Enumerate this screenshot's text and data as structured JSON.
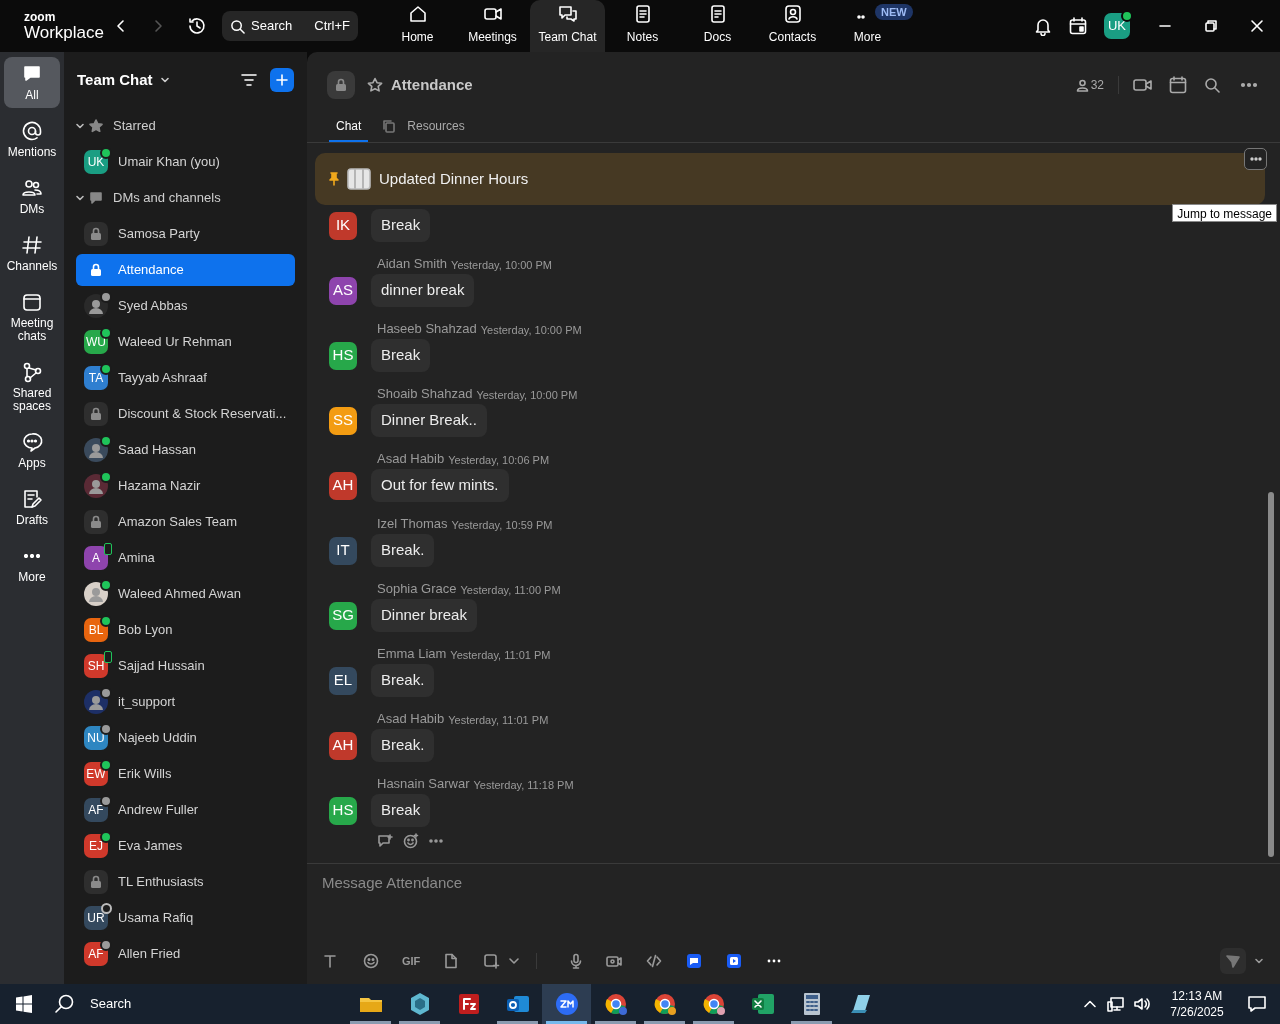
{
  "app": {
    "logo_top": "zoom",
    "logo_bottom": "Workplace"
  },
  "search": {
    "placeholder": "Search",
    "shortcut": "Ctrl+F"
  },
  "nav_tabs": [
    {
      "label": "Home",
      "selected": false
    },
    {
      "label": "Meetings",
      "selected": false
    },
    {
      "label": "Team Chat",
      "selected": true
    },
    {
      "label": "Notes",
      "selected": false
    },
    {
      "label": "Docs",
      "selected": false
    },
    {
      "label": "Contacts",
      "selected": false
    },
    {
      "label": "More",
      "selected": false,
      "badge": "NEW"
    }
  ],
  "profile": {
    "initials": "UK",
    "color": "#1a9e83",
    "presence": {
      "kind": "dot",
      "color": "#1fc45a"
    }
  },
  "rail": [
    {
      "label": "All",
      "selected": true
    },
    {
      "label": "Mentions",
      "selected": false
    },
    {
      "label": "DMs",
      "selected": false
    },
    {
      "label": "Channels",
      "selected": false
    },
    {
      "label": "Meeting chats",
      "selected": false
    },
    {
      "label": "Shared spaces",
      "selected": false
    },
    {
      "label": "Apps",
      "selected": false
    },
    {
      "label": "Drafts",
      "selected": false
    },
    {
      "label": "More",
      "selected": false
    }
  ],
  "sidebar": {
    "title": "Team Chat",
    "sections": [
      {
        "label": "Starred",
        "expanded": true,
        "items": [
          {
            "kind": "initials",
            "name": "Umair Khan (you)",
            "initials": "UK",
            "color": "#1a9e83",
            "presence": {
              "kind": "dot",
              "color": "#1fc45a"
            },
            "selected": false
          }
        ]
      },
      {
        "label": "DMs and channels",
        "expanded": true,
        "items": [
          {
            "kind": "channel",
            "name": "Samosa Party",
            "selected": false
          },
          {
            "kind": "channel",
            "name": "Attendance",
            "selected": true
          },
          {
            "kind": "photo",
            "name": "Syed Abbas",
            "color": "#2a2a2a",
            "presence": {
              "kind": "dot",
              "color": "#9a9a9a"
            },
            "selected": false
          },
          {
            "kind": "initials",
            "name": "Waleed Ur Rehman",
            "initials": "WU",
            "color": "#27a84a",
            "presence": {
              "kind": "dot",
              "color": "#1fc45a"
            },
            "selected": false
          },
          {
            "kind": "initials",
            "name": "Tayyab Ashraaf",
            "initials": "TA",
            "color": "#2f7fd0",
            "presence": {
              "kind": "dot",
              "color": "#1fc45a"
            },
            "selected": false
          },
          {
            "kind": "channel",
            "name": "Discount & Stock Reservati...",
            "selected": false
          },
          {
            "kind": "photo",
            "name": "Saad Hassan",
            "color": "#3a4a5c",
            "presence": {
              "kind": "dot",
              "color": "#1fc45a"
            },
            "selected": false
          },
          {
            "kind": "photo",
            "name": "Hazama Nazir",
            "color": "#5a2a35",
            "presence": {
              "kind": "dot",
              "color": "#1fc45a"
            },
            "selected": false
          },
          {
            "kind": "channel",
            "name": "Amazon Sales Team",
            "selected": false
          },
          {
            "kind": "initials",
            "name": "Amina",
            "initials": "A",
            "color": "#8e44ad",
            "presence": {
              "kind": "mobile",
              "color": "#1fc45a"
            },
            "selected": false
          },
          {
            "kind": "photo",
            "name": "Waleed Ahmed Awan",
            "color": "#d8d0c8",
            "presence": {
              "kind": "dot",
              "color": "#1fc45a"
            },
            "selected": false
          },
          {
            "kind": "initials",
            "name": "Bob Lyon",
            "initials": "BL",
            "color": "#e8650f",
            "presence": {
              "kind": "dot",
              "color": "#1fc45a"
            },
            "selected": false
          },
          {
            "kind": "initials",
            "name": "Sajjad Hussain",
            "initials": "SH",
            "color": "#d0392b",
            "presence": {
              "kind": "mobile",
              "color": "#1fc45a"
            },
            "selected": false
          },
          {
            "kind": "photo",
            "name": "it_support",
            "color": "#1d2f66",
            "presence": {
              "kind": "dot",
              "color": "#9a9a9a"
            },
            "selected": false
          },
          {
            "kind": "initials",
            "name": "Najeeb Uddin",
            "initials": "NU",
            "color": "#2e86c1",
            "presence": {
              "kind": "dot",
              "color": "#9a9a9a"
            },
            "selected": false
          },
          {
            "kind": "initials",
            "name": "Erik Wills",
            "initials": "EW",
            "color": "#d0392b",
            "presence": {
              "kind": "dot",
              "color": "#1fc45a"
            },
            "selected": false
          },
          {
            "kind": "initials",
            "name": "Andrew Fuller",
            "initials": "AF",
            "color": "#34495e",
            "presence": {
              "kind": "dot",
              "color": "#9a9a9a"
            },
            "selected": false
          },
          {
            "kind": "initials",
            "name": "Eva James",
            "initials": "EJ",
            "color": "#d0392b",
            "presence": {
              "kind": "dot",
              "color": "#1fc45a"
            },
            "selected": false
          },
          {
            "kind": "channel",
            "name": "TL Enthusiasts",
            "selected": false
          },
          {
            "kind": "initials",
            "name": "Usama Rafiq",
            "initials": "UR",
            "color": "#34495e",
            "presence": {
              "kind": "ring",
              "color": "#bbbbbb"
            },
            "selected": false
          },
          {
            "kind": "initials",
            "name": "Allen Fried",
            "initials": "AF",
            "color": "#d0392b",
            "presence": {
              "kind": "dot",
              "color": "#9a9a9a"
            },
            "selected": false
          }
        ]
      }
    ]
  },
  "channel": {
    "name": "Attendance",
    "member_count": "32",
    "tabs": [
      {
        "label": "Chat",
        "selected": true
      },
      {
        "label": "Resources",
        "selected": false
      }
    ],
    "pinned": {
      "title": "Updated Dinner Hours",
      "tooltip": "Jump to message"
    },
    "messages": [
      {
        "initials": "IK",
        "color": "#c0392b",
        "text": "Break"
      },
      {
        "initials": "AS",
        "color": "#8e44ad",
        "author": "Aidan Smith",
        "time": "Yesterday, 10:00 PM",
        "text": "dinner break"
      },
      {
        "initials": "HS",
        "color": "#27a84a",
        "author": "Haseeb Shahzad",
        "time": "Yesterday, 10:00 PM",
        "text": "Break"
      },
      {
        "initials": "SS",
        "color": "#f39c12",
        "author": "Shoaib Shahzad",
        "time": "Yesterday, 10:00 PM",
        "text": "Dinner Break.."
      },
      {
        "initials": "AH",
        "color": "#c0392b",
        "author": "Asad Habib",
        "time": "Yesterday, 10:06 PM",
        "text": "Out for few mints."
      },
      {
        "initials": "IT",
        "color": "#34495e",
        "author": "Izel Thomas",
        "time": "Yesterday, 10:59 PM",
        "text": "Break."
      },
      {
        "initials": "SG",
        "color": "#27a84a",
        "author": "Sophia Grace",
        "time": "Yesterday, 11:00 PM",
        "text": "Dinner break"
      },
      {
        "initials": "EL",
        "color": "#34495e",
        "author": "Emma Liam",
        "time": "Yesterday, 11:01 PM",
        "text": "Break."
      },
      {
        "initials": "AH",
        "color": "#c0392b",
        "author": "Asad Habib",
        "time": "Yesterday, 11:01 PM",
        "text": "Break."
      },
      {
        "initials": "HS",
        "color": "#27a84a",
        "author": "Hasnain Sarwar",
        "time": "Yesterday, 11:18 PM",
        "text": "Break"
      }
    ]
  },
  "composer": {
    "placeholder": "Message Attendance",
    "gif_label": "GIF"
  },
  "taskbar": {
    "search_placeholder": "Search",
    "time": "12:13 AM",
    "date": "7/26/2025",
    "apps": [
      {
        "running": true,
        "selected": false
      },
      {
        "running": true,
        "selected": false
      },
      {
        "running": false,
        "selected": false
      },
      {
        "running": true,
        "selected": false
      },
      {
        "running": true,
        "selected": true
      },
      {
        "running": true,
        "selected": false
      },
      {
        "running": true,
        "selected": false
      },
      {
        "running": true,
        "selected": false
      },
      {
        "running": false,
        "selected": false
      },
      {
        "running": true,
        "selected": false
      },
      {
        "running": false,
        "selected": false
      }
    ]
  }
}
